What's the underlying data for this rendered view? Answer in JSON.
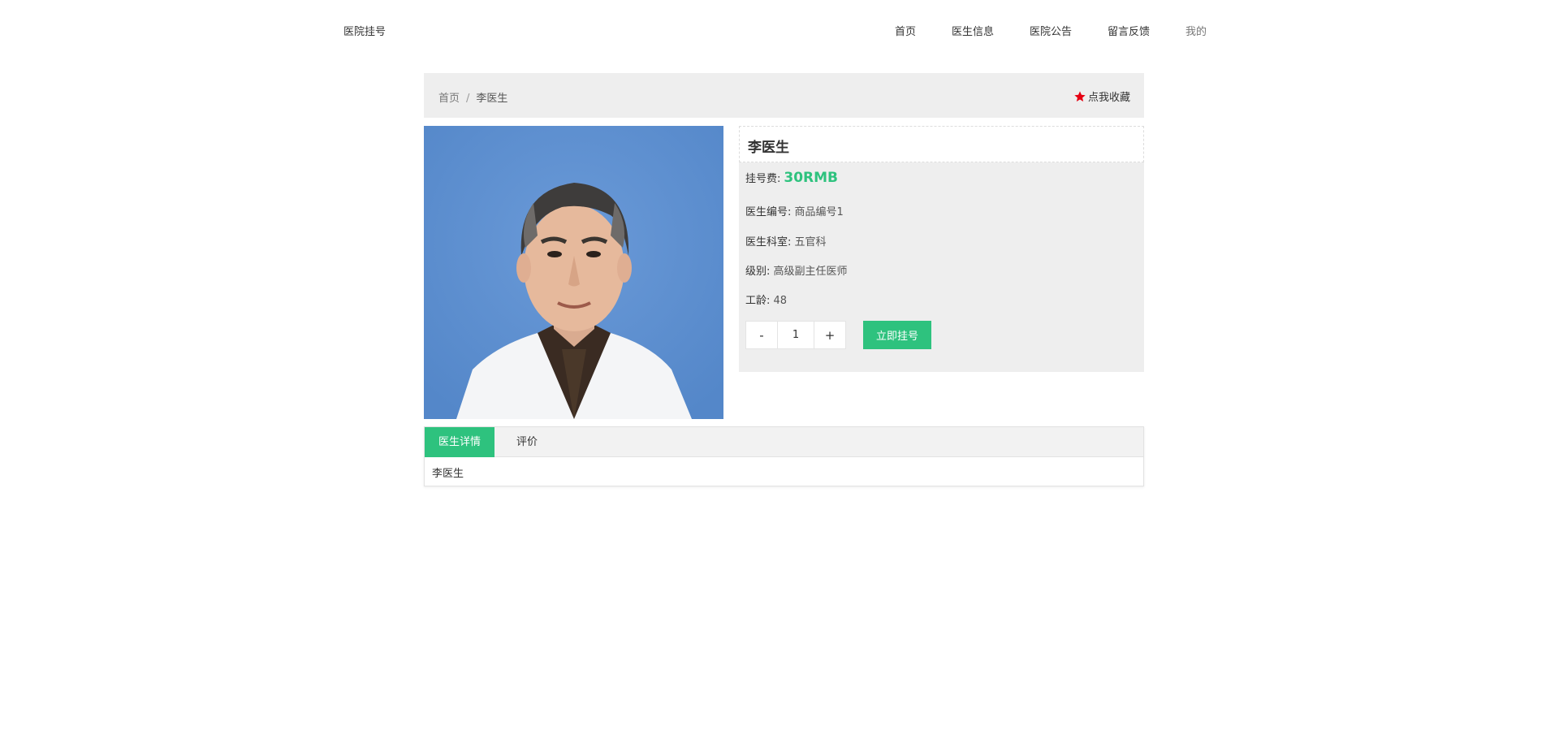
{
  "header": {
    "logo": "医院挂号",
    "nav": {
      "home": "首页",
      "doctor_info": "医生信息",
      "hospital_notice": "医院公告",
      "feedback": "留言反馈",
      "mine": "我的"
    }
  },
  "breadcrumb": {
    "home": "首页",
    "separator": "/",
    "current": "李医生",
    "favorite": "点我收藏"
  },
  "doctor": {
    "name": "李医生",
    "fee_label": "挂号费:",
    "fee_value": "30RMB",
    "code_label": "医生编号:",
    "code_value": "商品编号1",
    "dept_label": "医生科室:",
    "dept_value": "五官科",
    "level_label": "级别:",
    "level_value": "高级副主任医师",
    "age_label": "工龄:",
    "age_value": "48"
  },
  "quantity": {
    "minus": "-",
    "value": "1",
    "plus": "+"
  },
  "book_button": "立即挂号",
  "tabs": {
    "detail": "医生详情",
    "review": "评价",
    "content": "李医生"
  },
  "colors": {
    "accent": "#2ec27e",
    "star": "#e60012",
    "panel_bg": "#eeeeee"
  },
  "icons": {
    "favorite": "star-icon"
  }
}
